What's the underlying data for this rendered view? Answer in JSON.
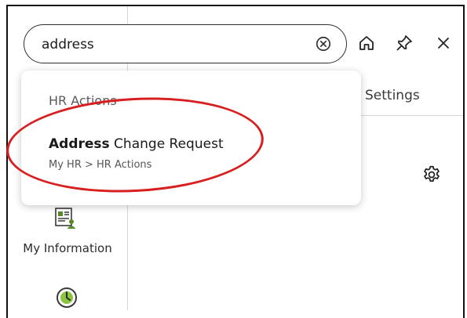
{
  "search": {
    "value": "address",
    "clear_icon": "clear-circle-x-icon"
  },
  "toolbar": {
    "home_icon": "home-icon",
    "pin_icon": "pin-icon",
    "close_icon": "close-icon"
  },
  "tabs": {
    "settings_label": "Settings"
  },
  "dropdown": {
    "group_label": "HR Actions",
    "result": {
      "title_bold": "Address",
      "title_rest": " Change Request",
      "path": "My HR > HR Actions"
    }
  },
  "content": {
    "settings_icon": "gear-icon"
  },
  "sidebar": {
    "items": [
      {
        "label": "My Information",
        "icon": "id-card-person-icon"
      },
      {
        "label": "",
        "icon": "clock-icon"
      }
    ]
  },
  "colors": {
    "annotation_red": "#d81f1f",
    "border_dark": "#2f2f2f",
    "icon_green": "#5a8a2a"
  }
}
